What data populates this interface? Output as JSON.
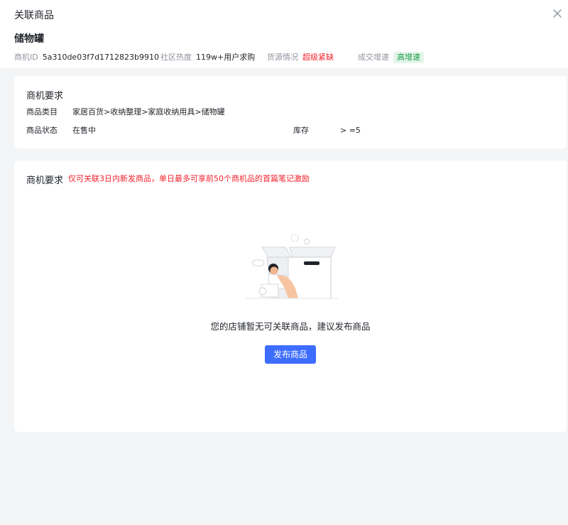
{
  "modal": {
    "title": "关联商品",
    "product_name": "储物罐"
  },
  "meta": {
    "id_label": "商机ID",
    "id_value": "5a310de03f7d1712823b9910",
    "heat_label": "社区热度",
    "heat_value": "119w+用户求购",
    "supply_label": "货源情况",
    "supply_value": "超级紧缺",
    "growth_label": "成交增速",
    "growth_value": "高增速"
  },
  "requirements": {
    "title": "商机要求",
    "category_label": "商品类目",
    "category_value": "家居百货>收纳整理>家庭收纳用具>储物罐",
    "status_label": "商品状态",
    "status_value": "在售中",
    "stock_label": "库存",
    "stock_value": "> =5"
  },
  "empty": {
    "title": "商机要求",
    "note": "仅可关联3日内新发商品，单日最多可享前50个商机品的首篇笔记激励",
    "message": "您的店铺暂无可关联商品，建议发布商品",
    "button": "发布商品"
  },
  "colors": {
    "accent": "#3d6dff",
    "warning": "#f5222d",
    "success": "#1a9e4b"
  },
  "icons": {
    "close": "close-icon",
    "empty": "empty-box-illustration"
  }
}
